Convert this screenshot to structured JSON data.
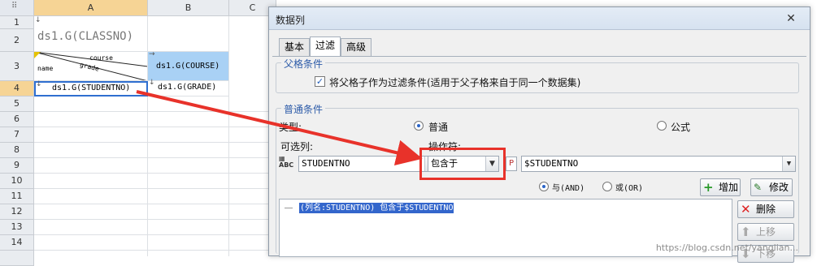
{
  "sheet": {
    "columns": [
      "A",
      "B",
      "C"
    ],
    "rows": [
      "1",
      "2",
      "3",
      "4",
      "5",
      "6",
      "7",
      "8",
      "9",
      "10",
      "11",
      "12",
      "13",
      "14"
    ],
    "cells": {
      "title": "ds1.G(CLASSNO)",
      "diag_top": "course",
      "diag_mid": "grade",
      "diag_left": "name",
      "b3": "ds1.G(COURSE)",
      "a4": "ds1.G(STUDENTNO)",
      "b4": "ds1.G(GRADE)"
    }
  },
  "dialog": {
    "title": "数据列",
    "close": "✕",
    "tabs": [
      "基本",
      "过滤",
      "高级"
    ],
    "active_tab": "过滤",
    "parent_section": {
      "legend": "父格条件",
      "checkbox_label": "将父格子作为过滤条件(适用于父子格来自于同一个数据集)",
      "checked": true
    },
    "normal_section": {
      "legend": "普通条件",
      "type_label": "类型:",
      "radio_normal": "普通",
      "radio_formula": "公式",
      "selected_type": "普通",
      "column_label": "可选列:",
      "operator_label": "操作符:",
      "column_value": "STUDENTNO",
      "operator_value": "包含于",
      "param_icon": "P",
      "param_value": "$STUDENTNO",
      "and_label": "与(AND)",
      "or_label": "或(OR)",
      "selected_logic": "与(AND)",
      "add_button": "增加",
      "modify_button": "修改",
      "delete_button": "删除",
      "up_button": "上移",
      "down_button": "下移",
      "condition_item": "(列名:STUDENTNO) 包含于$STUDENTNO"
    }
  },
  "annotation": {
    "arrow_color": "#e8322a",
    "highlight_color": "#e8322a"
  },
  "watermark": "https://blog.csdn.net/yanglian..."
}
